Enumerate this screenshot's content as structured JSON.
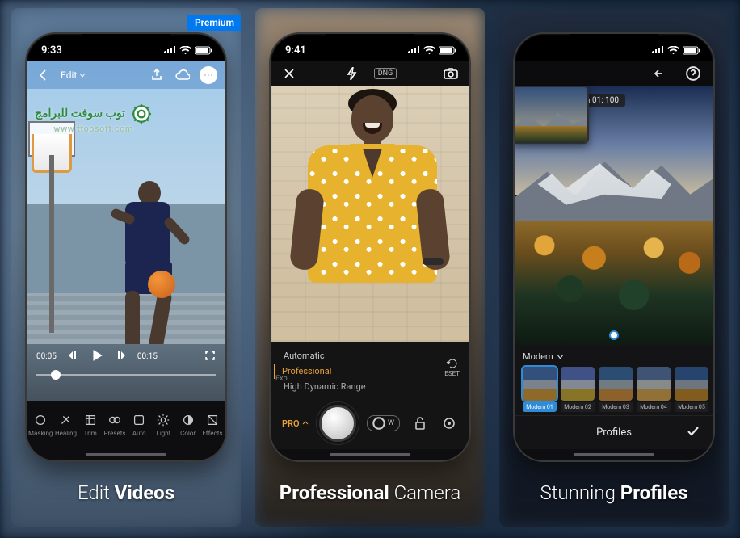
{
  "badge": "Premium",
  "captions": {
    "p1_a": "Edit ",
    "p1_b": "Videos",
    "p2_a": "Professional",
    "p2_b": " Camera",
    "p3_a": "Stunning ",
    "p3_b": "Profiles"
  },
  "watermark": {
    "line1": "توب سوفت للبرامج",
    "line2": "www.ttopsoft.com"
  },
  "panel1": {
    "status_time": "9:33",
    "edit_label": "Edit",
    "time_start": "00:05",
    "time_end": "00:15",
    "tools": [
      "Masking",
      "Healing",
      "Trim",
      "Presets",
      "Auto",
      "Light",
      "Color",
      "Effects"
    ]
  },
  "panel2": {
    "status_time": "9:41",
    "dng": "DNG",
    "modes": {
      "auto": "Automatic",
      "pro": "Professional",
      "hdr": "High Dynamic Range"
    },
    "exp_label": "Exp",
    "reset": "ESET",
    "pro_label": "PRO",
    "wb_label": "W"
  },
  "panel3": {
    "profile_badge": "odern 01: 100",
    "dropdown": "Modern",
    "presets": [
      "Modern 01",
      "Modern 02",
      "Modern 03",
      "Modern 04",
      "Modern 05"
    ],
    "profiles": "Profiles"
  }
}
